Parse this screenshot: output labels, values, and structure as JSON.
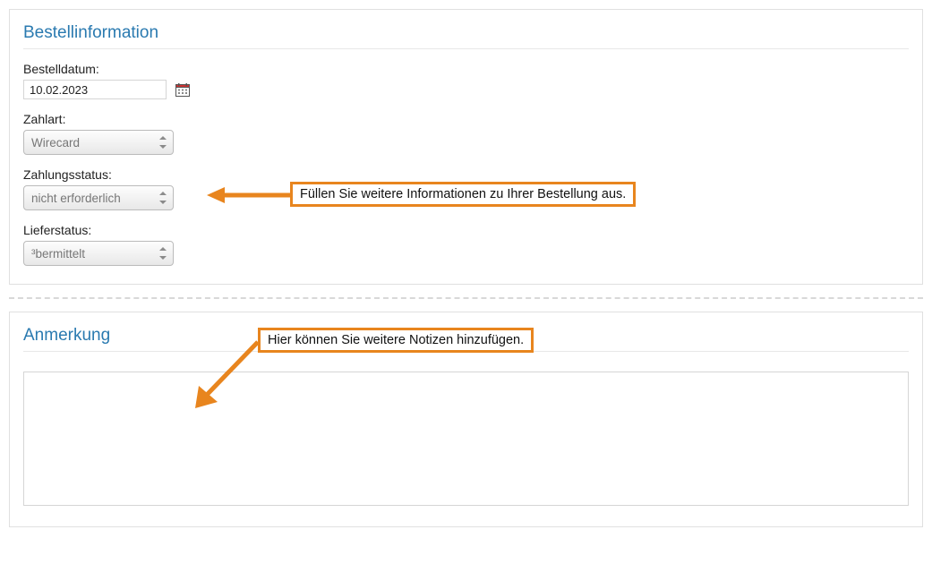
{
  "order_info": {
    "title": "Bestellinformation",
    "date_label": "Bestelldatum:",
    "date_value": "10.02.2023",
    "payment_label": "Zahlart:",
    "payment_value": "Wirecard",
    "status_label": "Zahlungsstatus:",
    "status_value": "nicht erforderlich",
    "delivery_label": "Lieferstatus:",
    "delivery_value": "³bermittelt",
    "callout": "Füllen Sie weitere Informationen zu Ihrer Bestellung aus."
  },
  "note": {
    "title": "Anmerkung",
    "callout": "Hier können Sie weitere Notizen hinzufügen.",
    "value": ""
  }
}
